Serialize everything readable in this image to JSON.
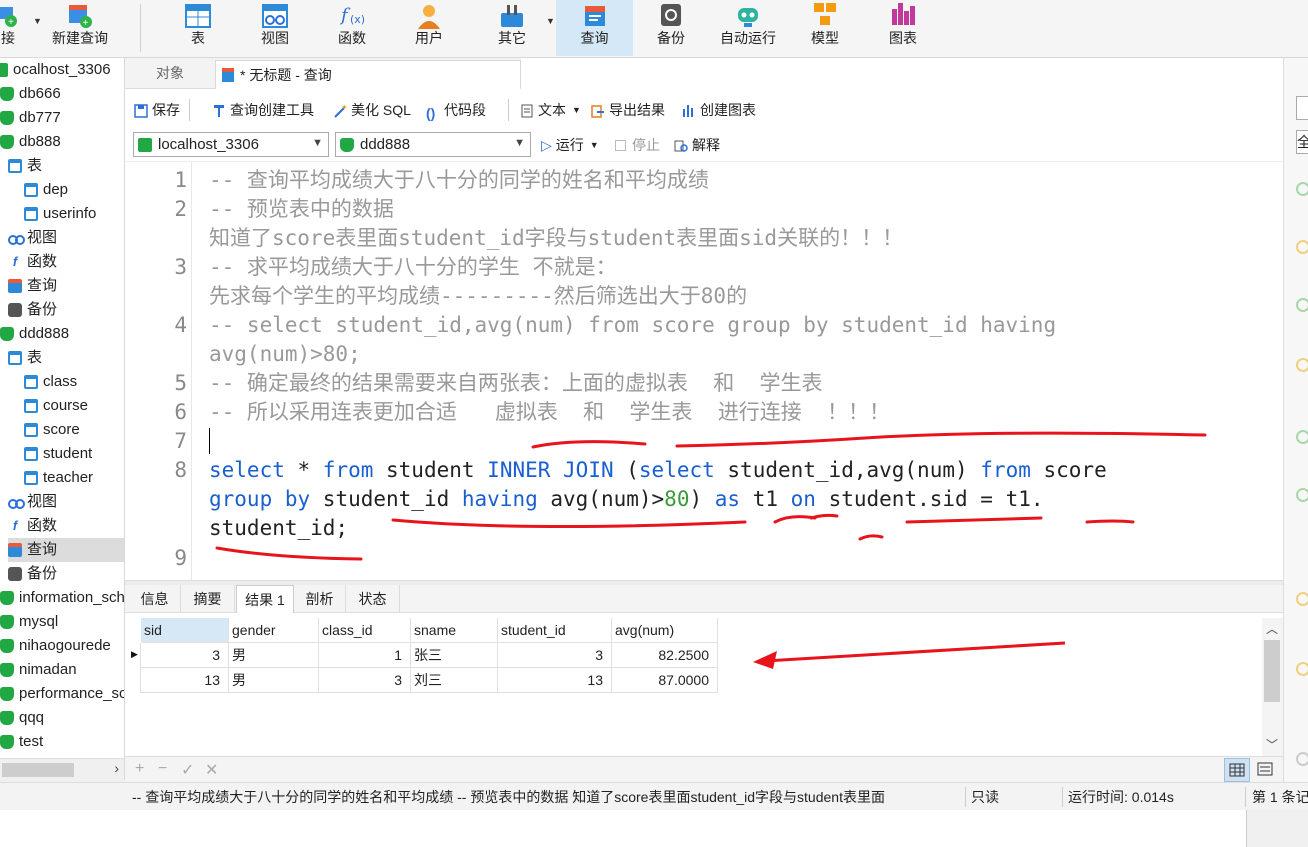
{
  "toolbar": {
    "items": [
      {
        "label": "接",
        "icon": "connection-icon"
      },
      {
        "label": "新建查询",
        "icon": "new-query-icon"
      },
      {
        "label": "表",
        "icon": "table-icon"
      },
      {
        "label": "视图",
        "icon": "view-icon"
      },
      {
        "label": "函数",
        "icon": "function-icon"
      },
      {
        "label": "用户",
        "icon": "user-icon"
      },
      {
        "label": "其它",
        "icon": "other-icon"
      },
      {
        "label": "查询",
        "icon": "query-icon"
      },
      {
        "label": "备份",
        "icon": "backup-icon"
      },
      {
        "label": "自动运行",
        "icon": "robot-icon"
      },
      {
        "label": "模型",
        "icon": "model-icon"
      },
      {
        "label": "图表",
        "icon": "chart-icon"
      }
    ],
    "active": "查询"
  },
  "tree": {
    "items": [
      {
        "label": "ocalhost_3306",
        "icon": "connection-icon"
      },
      {
        "label": "db666",
        "icon": "database-icon"
      },
      {
        "label": "db777",
        "icon": "database-icon"
      },
      {
        "label": "db888",
        "icon": "database-icon"
      },
      {
        "label": "表",
        "icon": "table-icon"
      },
      {
        "label": "dep",
        "icon": "table-icon"
      },
      {
        "label": "userinfo",
        "icon": "table-icon"
      },
      {
        "label": "视图",
        "icon": "view-icon"
      },
      {
        "label": "函数",
        "icon": "function-icon"
      },
      {
        "label": "查询",
        "icon": "query-icon"
      },
      {
        "label": "备份",
        "icon": "backup-icon"
      },
      {
        "label": "ddd888",
        "icon": "database-icon"
      },
      {
        "label": "表",
        "icon": "table-icon"
      },
      {
        "label": "class",
        "icon": "table-icon"
      },
      {
        "label": "course",
        "icon": "table-icon"
      },
      {
        "label": "score",
        "icon": "table-icon"
      },
      {
        "label": "student",
        "icon": "table-icon"
      },
      {
        "label": "teacher",
        "icon": "table-icon"
      },
      {
        "label": "视图",
        "icon": "view-icon"
      },
      {
        "label": "函数",
        "icon": "function-icon"
      },
      {
        "label": "查询",
        "icon": "query-icon"
      },
      {
        "label": "备份",
        "icon": "backup-icon"
      },
      {
        "label": "information_sch",
        "icon": "database-icon"
      },
      {
        "label": "mysql",
        "icon": "database-icon"
      },
      {
        "label": "nihaogourede",
        "icon": "database-icon"
      },
      {
        "label": "nimadan",
        "icon": "database-icon"
      },
      {
        "label": "performance_sc",
        "icon": "database-icon"
      },
      {
        "label": "qqq",
        "icon": "database-icon"
      },
      {
        "label": "test",
        "icon": "database-icon"
      }
    ],
    "selected": "查询"
  },
  "tabs": {
    "objects": "对象",
    "query": "* 无标题 - 查询"
  },
  "editor_toolbar": {
    "save": "保存",
    "query_builder": "查询创建工具",
    "beautify": "美化 SQL",
    "snippet": "代码段",
    "text": "文本",
    "export": "导出结果",
    "create_chart": "创建图表"
  },
  "conn_row": {
    "connection": "localhost_3306",
    "database": "ddd888",
    "run": "运行",
    "stop": "停止",
    "explain": "解释"
  },
  "editor": {
    "line_numbers": [
      "1",
      "2",
      "3",
      "4",
      "5",
      "6",
      "7",
      "8",
      "9"
    ],
    "lines": [
      "-- 查询平均成绩大于八十分的同学的姓名和平均成绩",
      "-- 预览表中的数据",
      "知道了score表里面student_id字段与student表里面sid关联的！！！",
      "-- 求平均成绩大于八十分的学生 不就是：",
      "先求每个学生的平均成绩---------然后筛选出大于80的",
      "-- select student_id,avg(num) from score group by student_id having",
      "avg(num)>80;",
      "-- 确定最终的结果需要来自两张表：上面的虚拟表  和  学生表",
      "-- 所以采用连表更加合适   虚拟表  和  学生表  进行连接  ！！！"
    ],
    "sql_line1": {
      "select": "select",
      "star": " * ",
      "from": "from",
      "student": " student ",
      "join": "INNER JOIN",
      "paren": " (",
      "select2": "select",
      "cols": " student_id,avg(num) ",
      "from2": "from",
      "score": " score"
    },
    "sql_line2": {
      "group": "group by",
      "sid": " student_id ",
      "having": "having",
      "avg": " avg(num)>",
      "num": "80",
      "close": ") ",
      "as": "as",
      "t1": " t1 ",
      "on": "on",
      "cond": " student.sid = t1."
    },
    "sql_line3": "student_id;"
  },
  "results": {
    "tabs": [
      "信息",
      "摘要",
      "结果 1",
      "剖析",
      "状态"
    ],
    "active_tab": "结果 1",
    "columns": [
      "sid",
      "gender",
      "class_id",
      "sname",
      "student_id",
      "avg(num)"
    ],
    "rows": [
      [
        "3",
        "男",
        "1",
        "张三",
        "3",
        "82.2500"
      ],
      [
        "13",
        "男",
        "3",
        "刘三",
        "13",
        "87.0000"
      ]
    ]
  },
  "grid_footer": {
    "add": "+",
    "remove": "−",
    "apply": "✓",
    "discard": "✕"
  },
  "status": {
    "sql_preview": "-- 查询平均成绩大于八十分的同学的姓名和平均成绩 -- 预览表中的数据  知道了score表里面student_id字段与student表里面",
    "readonly": "只读",
    "runtime": "运行时间: 0.014s",
    "record": "第 1 条记"
  },
  "right_panel": {
    "top_label": "全"
  },
  "colors": {
    "keyword": "#1a5fd0",
    "number": "#3a9b3a",
    "comment": "#999999",
    "annotation_red": "#e8141b",
    "active_toolbar": "#d4e8f7"
  }
}
